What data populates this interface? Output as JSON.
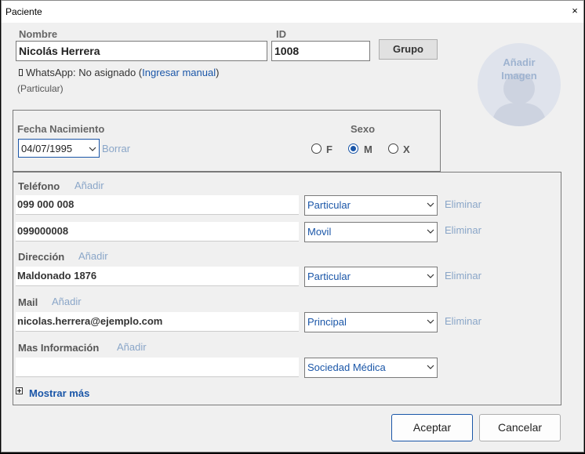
{
  "window": {
    "title": "Paciente",
    "close_glyph": "×"
  },
  "nombre": {
    "label": "Nombre",
    "value": "Nicolás Herrera"
  },
  "id": {
    "label": "ID",
    "value": "1008"
  },
  "grupo_button": "Grupo",
  "whatsapp": {
    "prefix": "WhatsApp: No asignado (",
    "link": "Ingresar manual",
    "suffix": ")"
  },
  "tipo_paciente": "(Particular)",
  "avatar": {
    "line1": "Añadir",
    "line2": "Imagen"
  },
  "fecha": {
    "label": "Fecha Nacimiento",
    "value": "04/07/1995",
    "clear": "Borrar"
  },
  "sexo": {
    "label": "Sexo",
    "options": [
      "F",
      "M",
      "X"
    ],
    "selected": "M"
  },
  "telefono": {
    "label": "Teléfono",
    "add": "Añadir",
    "rows": [
      {
        "value": "099 000 008",
        "type": "Particular",
        "remove": "Eliminar"
      },
      {
        "value": "099000008",
        "type": "Movil",
        "remove": "Eliminar"
      }
    ]
  },
  "direccion": {
    "label": "Dirección",
    "add": "Añadir",
    "rows": [
      {
        "value": "Maldonado 1876",
        "type": "Particular",
        "remove": "Eliminar"
      }
    ]
  },
  "mail": {
    "label": "Mail",
    "add": "Añadir",
    "rows": [
      {
        "value": "nicolas.herrera@ejemplo.com",
        "type": "Principal",
        "remove": "Eliminar"
      }
    ]
  },
  "mas_info": {
    "label": "Mas Información",
    "add": "Añadir",
    "rows": [
      {
        "value": "",
        "type": "Sociedad Médica"
      }
    ]
  },
  "mostrar_mas": "Mostrar más",
  "buttons": {
    "accept": "Aceptar",
    "cancel": "Cancelar"
  }
}
